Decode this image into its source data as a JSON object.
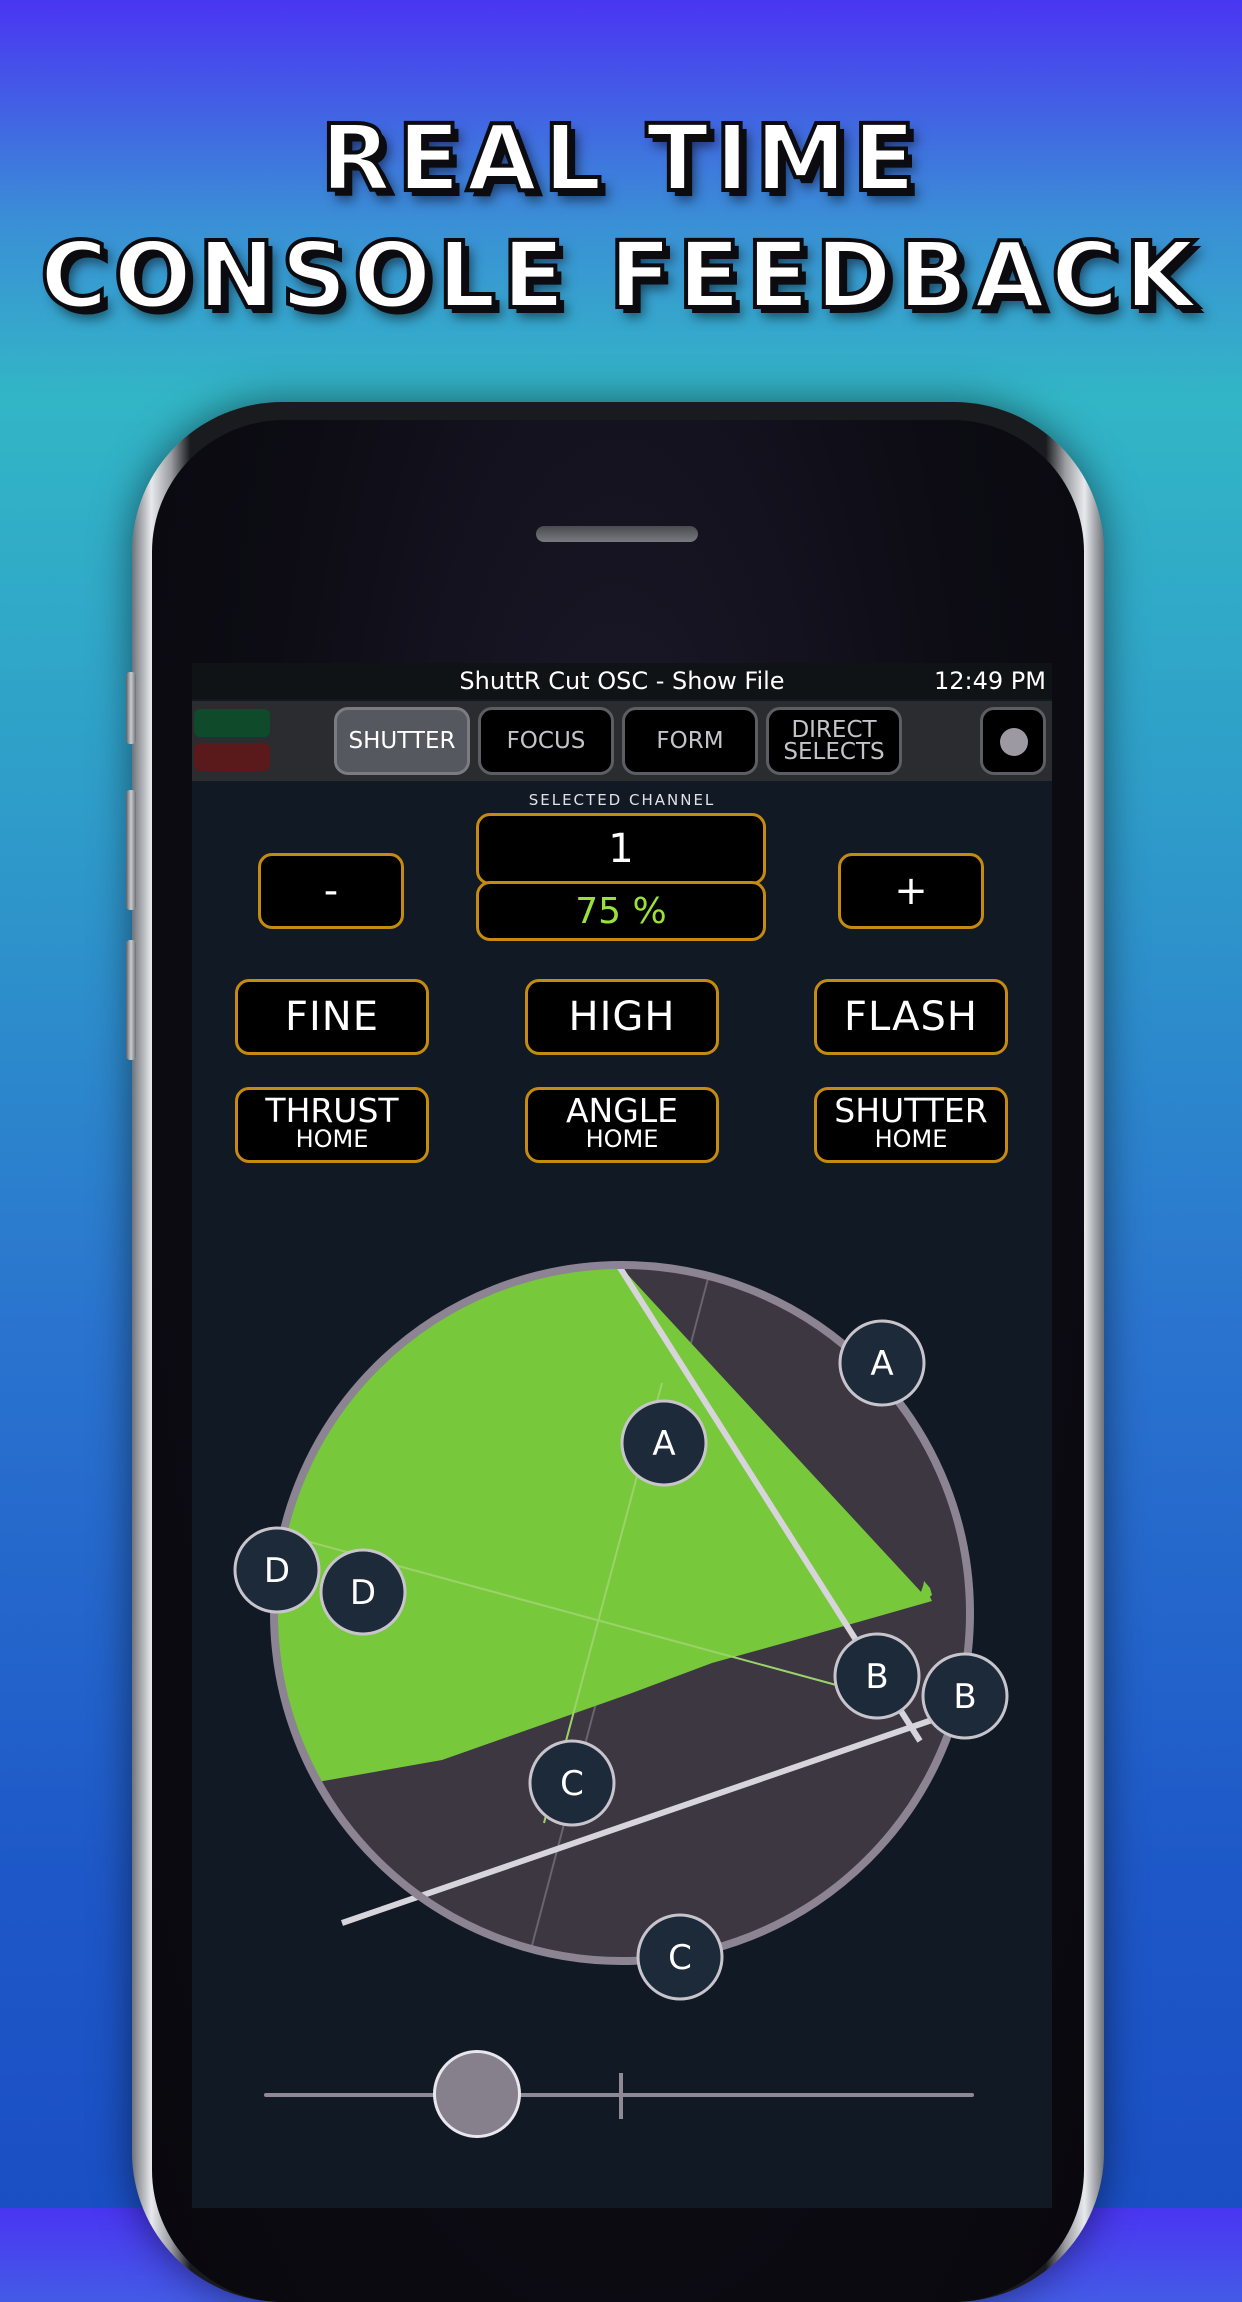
{
  "headline": {
    "line1": "REAL TIME",
    "line2": "CONSOLE FEEDBACK"
  },
  "status": {
    "title": "ShuttR Cut OSC - Show File",
    "time": "12:49 PM"
  },
  "tabs": [
    {
      "label": "SHUTTER",
      "active": true
    },
    {
      "label": "FOCUS",
      "active": false
    },
    {
      "label": "FORM",
      "active": false
    },
    {
      "label": "DIRECT SELECTS",
      "active": false
    }
  ],
  "channel": {
    "label": "SELECTED CHANNEL",
    "number": "1",
    "level": "75 %"
  },
  "buttons": {
    "minus": "-",
    "plus": "+",
    "fine": "FINE",
    "high": "HIGH",
    "flash": "FLASH",
    "thrust": {
      "line1": "THRUST",
      "line2": "HOME"
    },
    "angle": {
      "line1": "ANGLE",
      "line2": "HOME"
    },
    "shutter": {
      "line1": "SHUTTER",
      "line2": "HOME"
    }
  },
  "shutter_handles": {
    "inner": [
      "A",
      "B",
      "C",
      "D"
    ],
    "outer": [
      "A",
      "B",
      "C",
      "D"
    ]
  },
  "slider": {
    "value": 0.3
  },
  "colors": {
    "accent_border": "#c58a10",
    "level_text": "#9be13c",
    "beam_fill": "#77c93b",
    "shutter_fill": "#3d3742",
    "handle_fill": "#1c2a3a"
  }
}
